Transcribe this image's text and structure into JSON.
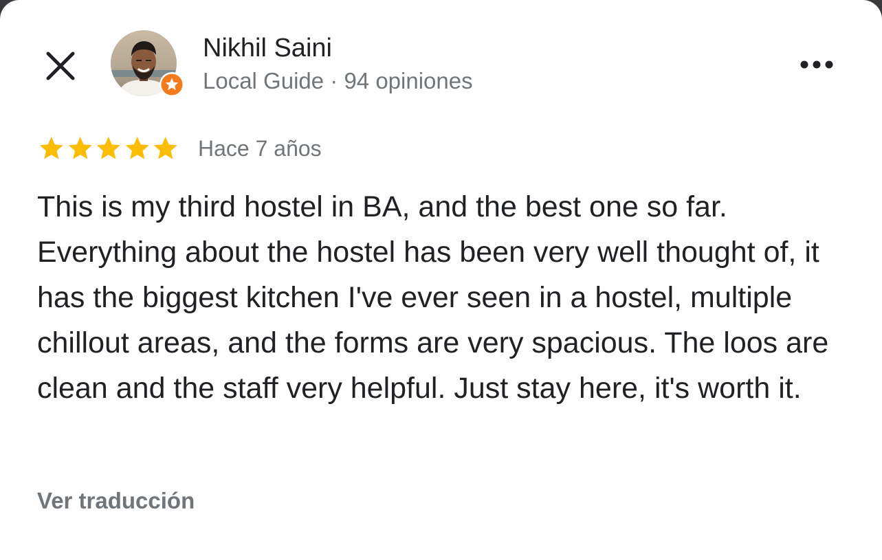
{
  "review": {
    "author": {
      "name": "Nikhil Saini",
      "meta": "Local Guide · 94 opiniones",
      "avatar_icon": "avatar-photo",
      "badge_icon": "local-guide-star-badge"
    },
    "rating": 5,
    "rating_max": 5,
    "date": "Hace 7 años",
    "text": "This is my third hostel in BA, and the best one so far. Everything about the hostel has been very well thought of, it has the biggest kitchen I've ever seen in a hostel, multiple chillout areas, and the forms are very spacious. The loos are clean and the staff very helpful. Just stay here, it's worth it.",
    "translate_label": "Ver traducción"
  },
  "icons": {
    "close": "close-icon",
    "more": "more-horizontal-icon",
    "star": "star-icon"
  },
  "colors": {
    "star": "#FBBC04",
    "badge": "#F27B1D",
    "primary_text": "#202124",
    "secondary_text": "#70757A",
    "background": "#FFFFFF"
  }
}
